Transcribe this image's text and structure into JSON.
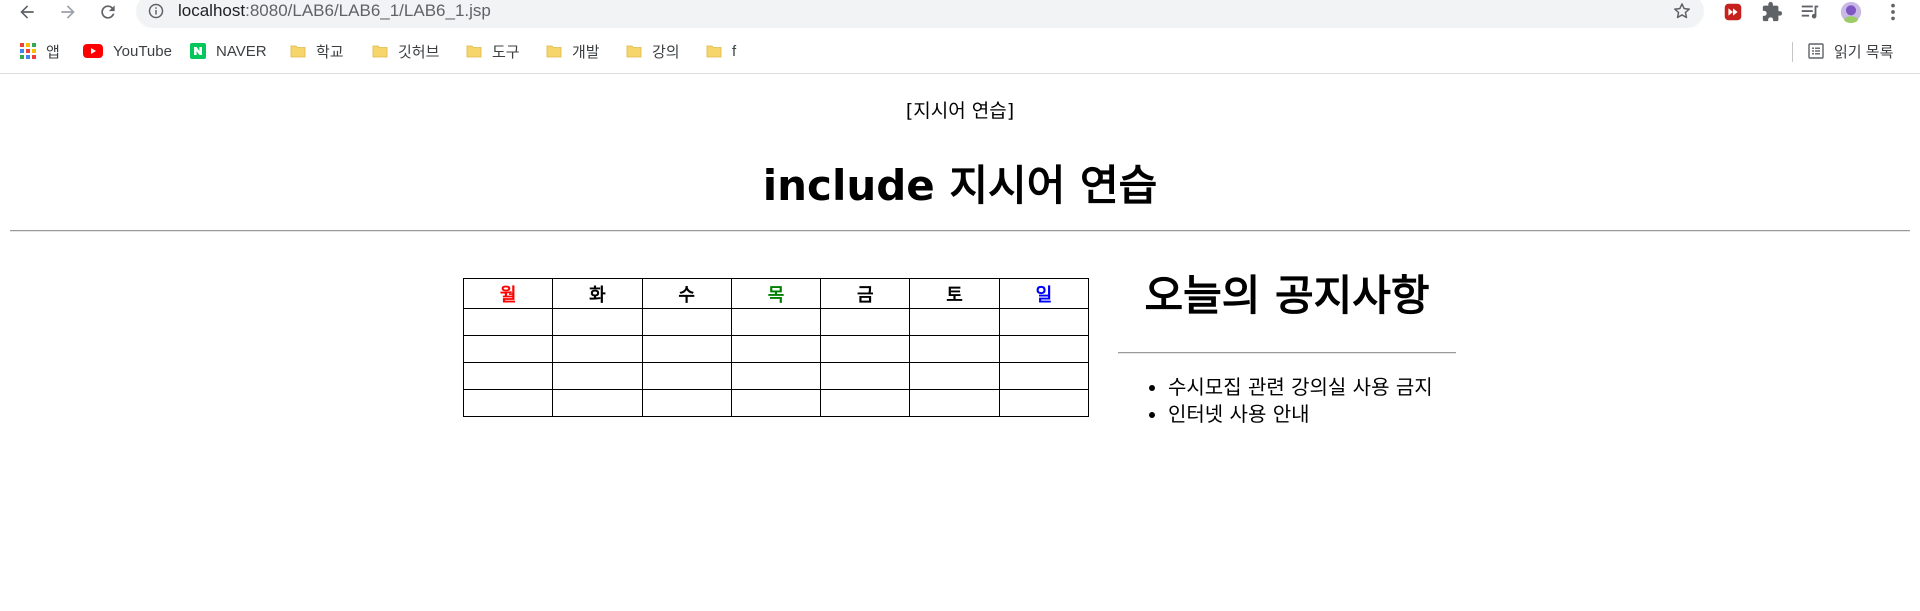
{
  "browser": {
    "url_host": "localhost",
    "url_path": ":8080/LAB6/LAB6_1/LAB6_1.jsp",
    "bookmarks": [
      {
        "label": "앱",
        "icon": "apps-grid-icon"
      },
      {
        "label": "YouTube",
        "icon": "youtube-icon"
      },
      {
        "label": "NAVER",
        "icon": "naver-icon"
      },
      {
        "label": "학교",
        "icon": "folder-icon"
      },
      {
        "label": "깃허브",
        "icon": "folder-icon"
      },
      {
        "label": "도구",
        "icon": "folder-icon"
      },
      {
        "label": "개발",
        "icon": "folder-icon"
      },
      {
        "label": "강의",
        "icon": "folder-icon"
      },
      {
        "label": "f",
        "icon": "folder-icon"
      }
    ],
    "reading_list": "읽기 목록",
    "colors": {
      "youtube": "#ff0000",
      "naver": "#03c75a",
      "folder": "#f6d56b",
      "ext_red": "#c5221f"
    }
  },
  "page": {
    "subtitle": "[지시어 연습]",
    "title": "include 지시어 연습",
    "days": [
      {
        "label": "월",
        "color": "#ff0000"
      },
      {
        "label": "화",
        "color": "#000000"
      },
      {
        "label": "수",
        "color": "#000000"
      },
      {
        "label": "목",
        "color": "#008000"
      },
      {
        "label": "금",
        "color": "#000000"
      },
      {
        "label": "토",
        "color": "#000000"
      },
      {
        "label": "일",
        "color": "#0000ff"
      }
    ],
    "empty_rows": 4,
    "notice": {
      "title": "오늘의 공지사항",
      "items": [
        "수시모집 관련 강의실 사용 금지",
        "인터넷 사용 안내"
      ]
    }
  }
}
